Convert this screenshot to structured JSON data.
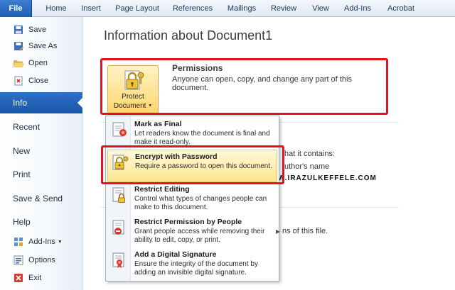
{
  "tabs": [
    "File",
    "Home",
    "Insert",
    "Page Layout",
    "References",
    "Mailings",
    "Review",
    "View",
    "Add-Ins",
    "Acrobat"
  ],
  "nav": {
    "save": "Save",
    "save_as": "Save As",
    "open": "Open",
    "close": "Close",
    "info": "Info",
    "recent": "Recent",
    "new": "New",
    "print": "Print",
    "save_send": "Save & Send",
    "help": "Help",
    "add_ins": "Add-Ins",
    "options": "Options",
    "exit": "Exit"
  },
  "main": {
    "title": "Information about Document1",
    "permissions_title": "Permissions",
    "permissions_desc": "Anyone can open, copy, and change any part of this document.",
    "protect_line1": "Protect",
    "protect_line2": "Document",
    "partial1": "that it contains:",
    "partial2": "uthor's name",
    "partial3": "ns of this file.",
    "watermark": "WWW.IRAZULKEFFELE.COM"
  },
  "menu": {
    "items": [
      {
        "title": "Mark as Final",
        "desc": "Let readers know the document is final and make it read-only."
      },
      {
        "title": "Encrypt with Password",
        "desc": "Require a password to open this document."
      },
      {
        "title": "Restrict Editing",
        "desc": "Control what types of changes people can make to this document."
      },
      {
        "title": "Restrict Permission by People",
        "desc": "Grant people access while removing their ability to edit, copy, or print."
      },
      {
        "title": "Add a Digital Signature",
        "desc": "Ensure the integrity of the document by adding an invisible digital signature."
      }
    ]
  },
  "colors": {
    "accent_blue": "#1d5fb4",
    "highlight_red": "#e0141e",
    "highlight_yellow": "#fde690"
  }
}
